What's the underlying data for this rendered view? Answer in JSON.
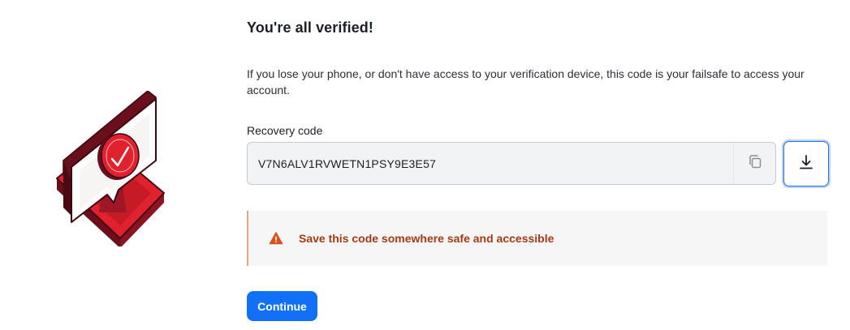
{
  "header": {
    "title": "You're all verified!",
    "description": "If you lose your phone, or don't have access to your verification device, this code is your failsafe to access your account."
  },
  "recovery": {
    "label": "Recovery code",
    "code": "V7N6ALV1RVWETN1PSY9E3E57",
    "copy_icon": "copy-icon",
    "download_icon": "download-icon"
  },
  "notice": {
    "icon": "warning-icon",
    "text": "Save this code somewhere safe and accessible"
  },
  "actions": {
    "continue_label": "Continue"
  },
  "colors": {
    "accent": "#1170f5",
    "warning_text": "#a23a12",
    "warning_icon": "#d6541c",
    "illustration_red": "#e0212e",
    "illustration_dark": "#6b0f1c"
  }
}
